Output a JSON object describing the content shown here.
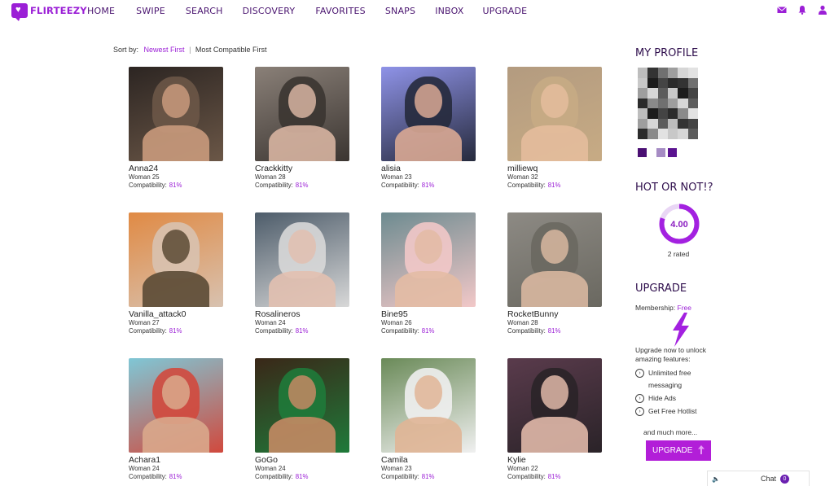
{
  "header": {
    "logo_text": "FLIRTEEZY",
    "nav": [
      "HOME",
      "SWIPE",
      "SEARCH",
      "DISCOVERY",
      "FAVORITES",
      "SNAPS",
      "INBOX",
      "UPGRADE"
    ],
    "icons": [
      "mail-icon",
      "bell-icon",
      "user-icon"
    ]
  },
  "sort": {
    "label": "Sort by:",
    "options": [
      "Newest First",
      "Most Compatible First"
    ],
    "active": "Newest First"
  },
  "compatibility_label": "Compatibility:",
  "profiles": [
    {
      "name": "Anna24",
      "meta": "Woman 25",
      "compat": "81%",
      "palette": [
        "#2c2522",
        "#c99a7c",
        "#6b5747"
      ]
    },
    {
      "name": "Crackkitty",
      "meta": "Woman 28",
      "compat": "81%",
      "palette": [
        "#8a8078",
        "#d7b4a1",
        "#3b3531"
      ]
    },
    {
      "name": "alisia",
      "meta": "Woman 23",
      "compat": "81%",
      "palette": [
        "#8f93e8",
        "#d9a894",
        "#262a3c"
      ]
    },
    {
      "name": "milliewq",
      "meta": "Woman 32",
      "compat": "81%",
      "palette": [
        "#b39b80",
        "#e4bd9c",
        "#c7ab84"
      ]
    },
    {
      "name": "Vanilla_attack0",
      "meta": "Woman 27",
      "compat": "81%",
      "palette": [
        "#e08a44",
        "#5a4a35",
        "#d8c2b0"
      ]
    },
    {
      "name": "Rosalineros",
      "meta": "Woman 24",
      "compat": "81%",
      "palette": [
        "#4d5c6a",
        "#e2c0b0",
        "#d8d8d8"
      ]
    },
    {
      "name": "Bine95",
      "meta": "Woman 26",
      "compat": "81%",
      "palette": [
        "#6d8b90",
        "#e3bba4",
        "#f2c8c8"
      ]
    },
    {
      "name": "RocketBunny",
      "meta": "Woman 28",
      "compat": "81%",
      "palette": [
        "#8d8a84",
        "#d8b7a0",
        "#6a6860"
      ]
    },
    {
      "name": "Achara1",
      "meta": "Woman 24",
      "compat": "81%",
      "palette": [
        "#7fc7d6",
        "#d9a98c",
        "#d1493d"
      ]
    },
    {
      "name": "GoGo",
      "meta": "Woman 24",
      "compat": "81%",
      "palette": [
        "#3a2718",
        "#c48a64",
        "#1f7a3a"
      ]
    },
    {
      "name": "Camila",
      "meta": "Woman 23",
      "compat": "81%",
      "palette": [
        "#6a8a58",
        "#e0b596",
        "#f0f0f0"
      ]
    },
    {
      "name": "Kylie",
      "meta": "Woman 22",
      "compat": "81%",
      "palette": [
        "#5a3b4c",
        "#e0b8a8",
        "#2a2328"
      ]
    }
  ],
  "my_profile": {
    "heading": "MY PROFILE",
    "thumb_colors": [
      "#4a0f73",
      "#ffffff",
      "#a68cc4",
      "#5a1390"
    ]
  },
  "hot_or_not": {
    "heading": "HOT OR NOT!?",
    "score": "4.00",
    "score_fraction": 0.8,
    "rated_text": "2 rated",
    "ring_color": "#a321e0"
  },
  "upgrade": {
    "heading": "UPGRADE",
    "membership_label": "Membership:",
    "membership_value": "Free",
    "note": "Upgrade now to unlock amazing features:",
    "features": [
      "Unlimited free messaging",
      "Hide Ads",
      "Get Free Hotlist"
    ],
    "more_text": "and much more...",
    "button_label": "UPGRADE"
  },
  "chat": {
    "label": "Chat",
    "count": "0",
    "speaker_icon": "speaker-icon"
  },
  "colors": {
    "brand": "#9b1fd6",
    "nav_text": "#4a1570",
    "button": "#b21ed8"
  }
}
